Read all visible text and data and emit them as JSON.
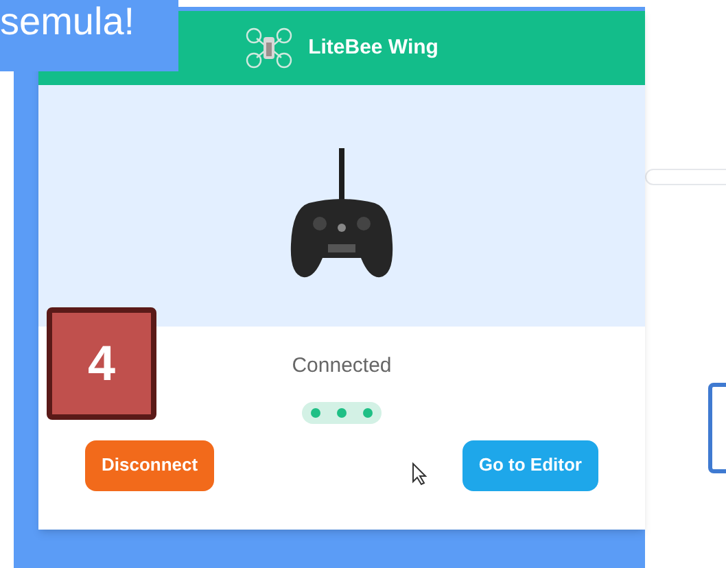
{
  "banner": {
    "text": "semula!"
  },
  "window": {
    "title": "LiteBee Wing"
  },
  "status": "Connected",
  "step_badge": "4",
  "buttons": [
    {
      "label": "Disconnect",
      "kind": "danger"
    },
    {
      "label": "Go to Editor",
      "kind": "primary"
    }
  ]
}
